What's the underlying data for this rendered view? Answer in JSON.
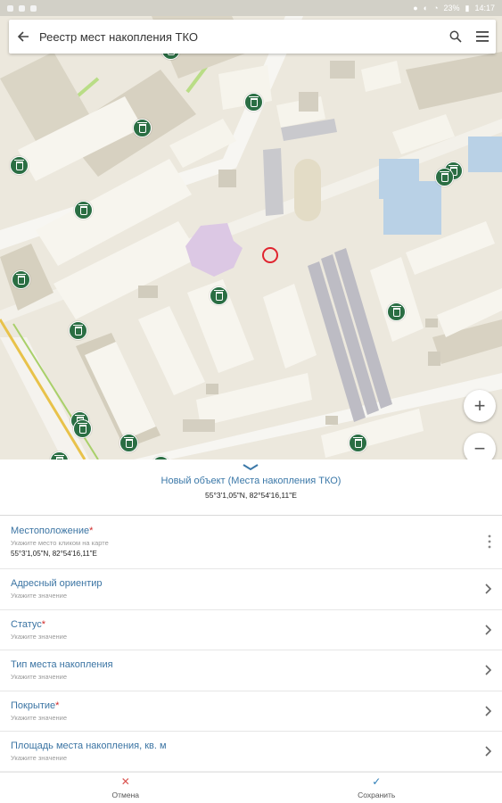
{
  "status_bar": {
    "battery": "23%",
    "time": "14:17"
  },
  "header": {
    "title": "Реестр мест накопления ТКО"
  },
  "object": {
    "title": "Новый объект (Места накопления ТКО)",
    "coords": "55°3'1,05\"N, 82°54'16,11\"E"
  },
  "fields": [
    {
      "label": "Местоположение",
      "required": "*",
      "hint": "Укажите место кликом на карте",
      "value": "55°3'1,05\"N, 82°54'16,11\"E"
    },
    {
      "label": "Адресный ориентир",
      "required": "",
      "hint": "Укажите значение"
    },
    {
      "label": "Статус",
      "required": "*",
      "hint": "Укажите значение"
    },
    {
      "label": "Тип места накопления",
      "required": "",
      "hint": "Укажите значение"
    },
    {
      "label": "Покрытие",
      "required": "*",
      "hint": "Укажите значение"
    },
    {
      "label": "Площадь места накопления, кв. м",
      "required": "",
      "hint": "Укажите значение"
    }
  ],
  "actions": {
    "cancel": "Отмена",
    "save": "Сохранить"
  },
  "zoom": {
    "in": "+",
    "out": "−"
  },
  "icons": {
    "back": "arrow-left-icon",
    "search": "search-icon",
    "menu": "hamburger-menu-icon",
    "marker": "trash-bin-icon",
    "chevron": "chevron-down-icon",
    "arrow": "chevron-right-icon",
    "more": "more-vertical-icon",
    "cancel": "close-icon",
    "save": "check-icon"
  },
  "colors": {
    "accent": "#3b78a8",
    "marker": "#2a6e43",
    "target": "#e0242f",
    "required": "#d02a2a",
    "save": "#2f7fb8",
    "cancel": "#d9534f"
  }
}
